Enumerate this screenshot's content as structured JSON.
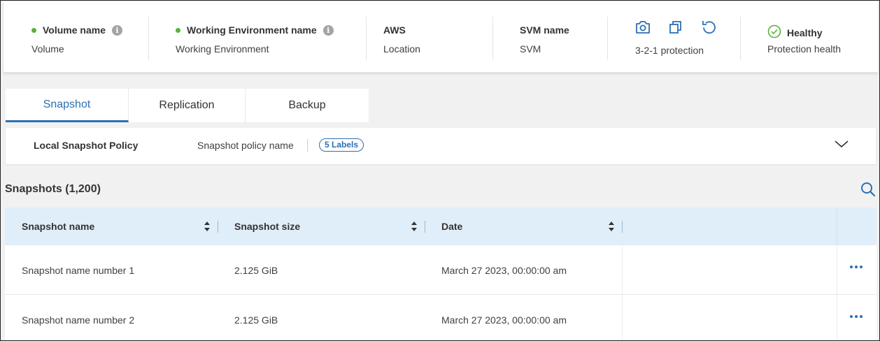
{
  "summary": {
    "volume": {
      "title": "Volume name",
      "subtitle": "Volume"
    },
    "working_env": {
      "title": "Working Environment name",
      "subtitle": "Working Environment"
    },
    "location": {
      "title": "AWS",
      "subtitle": "Location"
    },
    "svm": {
      "title": "SVM name",
      "subtitle": "SVM"
    },
    "protection": {
      "subtitle": "3-2-1 protection",
      "icons": [
        "camera-icon",
        "copy-icon",
        "restore-icon"
      ]
    },
    "health": {
      "title": "Healthy",
      "subtitle": "Protection health",
      "icon": "check-circle-icon"
    }
  },
  "tabs": [
    {
      "label": "Snapshot",
      "active": true
    },
    {
      "label": "Replication",
      "active": false
    },
    {
      "label": "Backup",
      "active": false
    }
  ],
  "policy": {
    "label": "Local Snapshot Policy",
    "name": "Snapshot policy name",
    "badge": "5 Labels"
  },
  "snapshots": {
    "title": "Snapshots (1,200)",
    "columns": [
      "Snapshot name",
      "Snapshot size",
      "Date"
    ],
    "rows": [
      {
        "name": "Snapshot name number 1",
        "size": "2.125 GiB",
        "date": "March 27 2023, 00:00:00 am"
      },
      {
        "name": "Snapshot name number 2",
        "size": "2.125 GiB",
        "date": "March 27 2023, 00:00:00 am"
      }
    ]
  },
  "colors": {
    "accent": "#2c6fb4",
    "status_green": "#57b23d",
    "header_row_bg": "#e0eefa"
  }
}
